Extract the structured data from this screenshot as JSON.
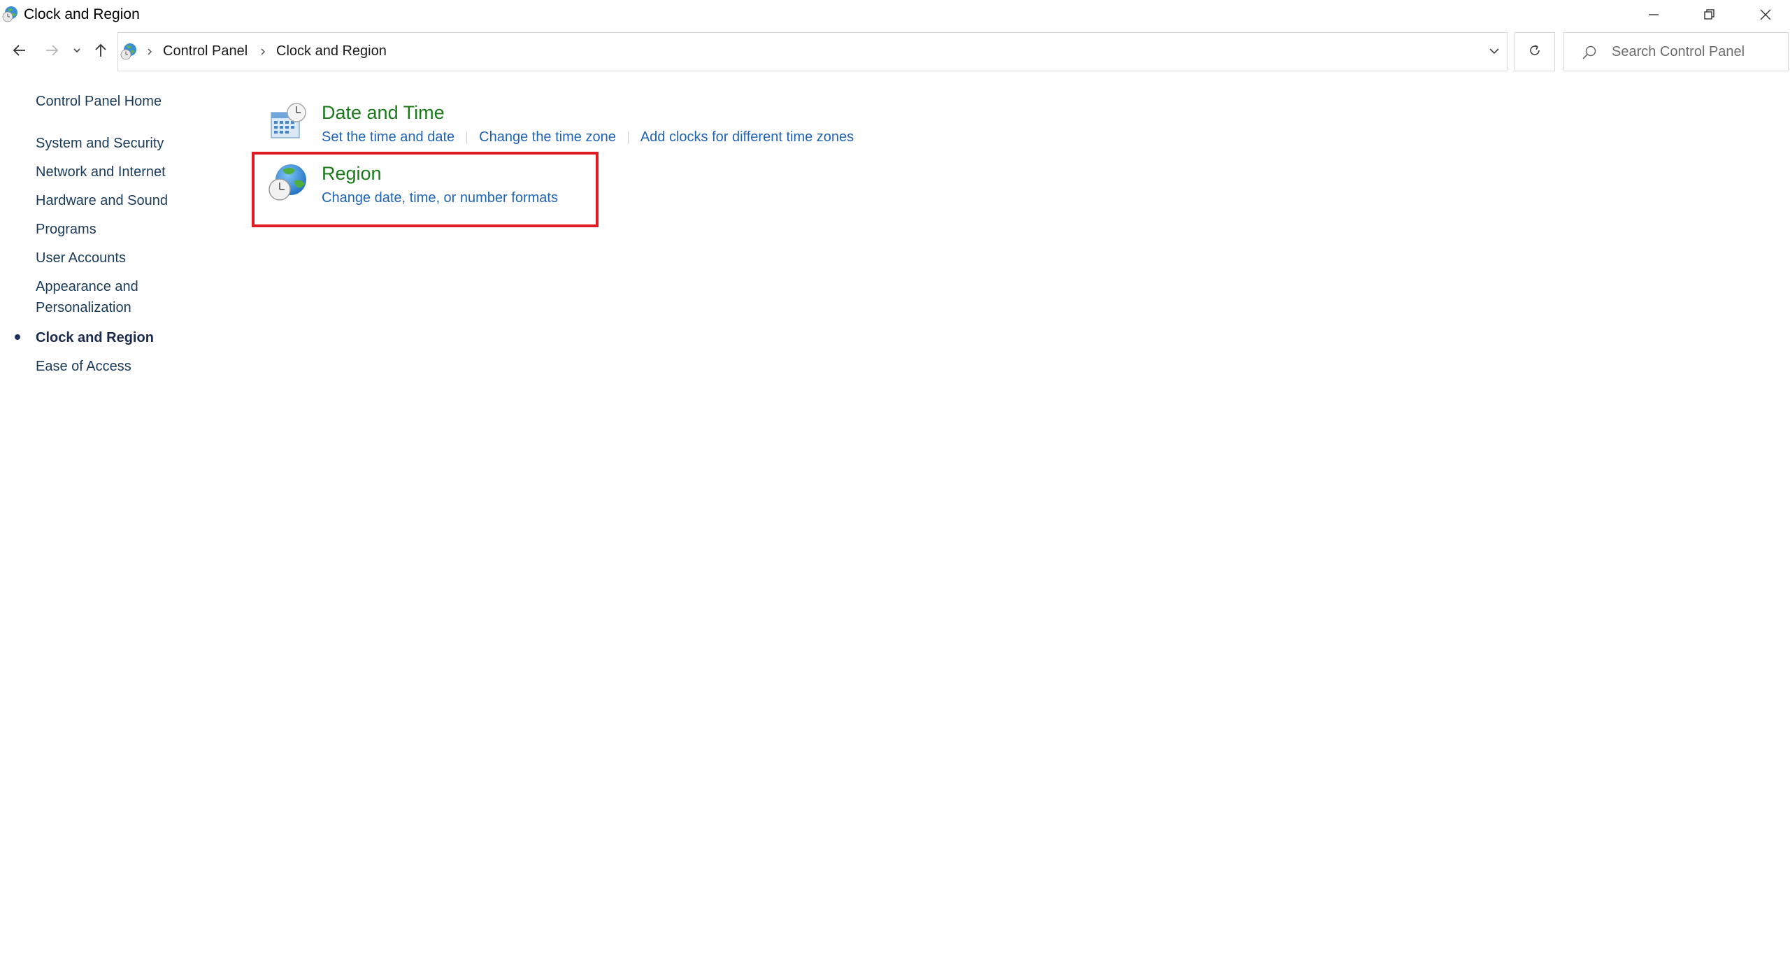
{
  "window": {
    "title": "Clock and Region",
    "minimize_icon": "minimize-icon",
    "maximize_icon": "restore-icon",
    "close_icon": "close-icon"
  },
  "nav": {
    "back_icon": "arrow-left-icon",
    "forward_icon": "arrow-right-icon",
    "recent_icon": "chevron-down-icon",
    "up_icon": "arrow-up-icon",
    "breadcrumb": [
      "Control Panel",
      "Clock and Region"
    ],
    "search_placeholder": "Search Control Panel"
  },
  "sidebar": {
    "home": "Control Panel Home",
    "items": [
      {
        "label": "System and Security"
      },
      {
        "label": "Network and Internet"
      },
      {
        "label": "Hardware and Sound"
      },
      {
        "label": "Programs"
      },
      {
        "label": "User Accounts"
      },
      {
        "label_line1": "Appearance and",
        "label_line2": "Personalization"
      },
      {
        "label": "Clock and Region",
        "current": true
      },
      {
        "label": "Ease of Access"
      }
    ]
  },
  "main": {
    "categories": [
      {
        "title": "Date and Time",
        "icon": "calendar-clock-icon",
        "links": [
          "Set the time and date",
          "Change the time zone",
          "Add clocks for different time zones"
        ]
      },
      {
        "title": "Region",
        "icon": "globe-clock-icon",
        "links": [
          "Change date, time, or number formats"
        ]
      }
    ]
  },
  "colors": {
    "category_title": "#1a7a1a",
    "link": "#1f63b5",
    "highlight": "#e01b24"
  }
}
